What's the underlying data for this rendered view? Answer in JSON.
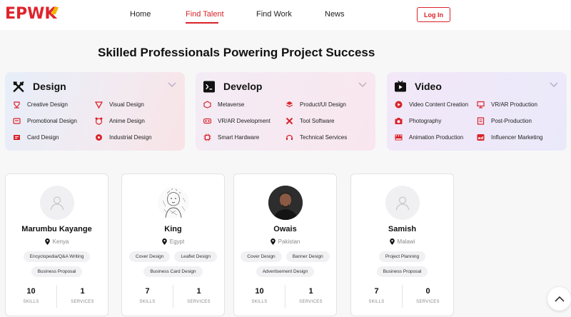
{
  "brand": {
    "logo_text_a": "EPW",
    "logo_text_b": "K"
  },
  "nav": {
    "items": [
      {
        "label": "Home"
      },
      {
        "label": "Find Talent"
      },
      {
        "label": "Find Work"
      },
      {
        "label": "News"
      }
    ],
    "active": "Find Talent",
    "login_label": "Log In"
  },
  "headline": "Skilled Professionals Powering Project Success",
  "categories": [
    {
      "title": "Design",
      "items": [
        "Creative Design",
        "Visual Design",
        "Promotional Design",
        "Anime Design",
        "Card Design",
        "Industrial Design"
      ]
    },
    {
      "title": "Develop",
      "items": [
        "Metaverse",
        "Product/UI Design",
        "VR/AR Development",
        "Tool Software",
        "Smart Hardware",
        "Technical Services"
      ]
    },
    {
      "title": "Video",
      "items": [
        "Video Content Creation",
        "VR/AR Production",
        "Photography",
        "Post-Production",
        "Animation Production",
        "Influencer Marketing"
      ]
    }
  ],
  "profiles": [
    {
      "name": "Marumbu Kayange",
      "country": "Kenya",
      "tags": [
        "Encyclopedia/Q&A Writing",
        "Business Proposal"
      ],
      "skills": "10",
      "services": "1",
      "skills_label": "SKILLS",
      "services_label": "SERVICES"
    },
    {
      "name": "King",
      "country": "Egypt",
      "tags": [
        "Cover Design",
        "Leaflet Design",
        "Business Card Design"
      ],
      "skills": "7",
      "services": "1",
      "skills_label": "SKILLS",
      "services_label": "SERVICES"
    },
    {
      "name": "Owais",
      "country": "Pakistan",
      "tags": [
        "Cover Design",
        "Banner Design",
        "Advertisement Design"
      ],
      "skills": "10",
      "services": "1",
      "skills_label": "SKILLS",
      "services_label": "SERVICES"
    },
    {
      "name": "Samish",
      "country": "Malawi",
      "tags": [
        "Project Planning",
        "Business Proposal"
      ],
      "skills": "7",
      "services": "0",
      "skills_label": "SKILLS",
      "services_label": "SERVICES"
    }
  ],
  "colors": {
    "accent": "#d9232b",
    "logo_yellow": "#f4b400"
  },
  "icons": {
    "design": "design-tools-icon",
    "develop": "terminal-icon",
    "video": "video-play-icon",
    "scroll_top": "chevron-up-icon"
  }
}
